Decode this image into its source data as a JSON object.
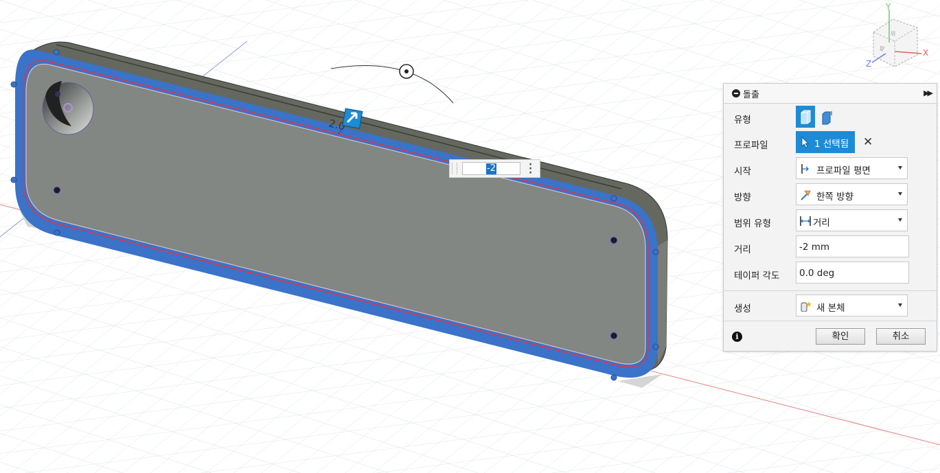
{
  "viewport": {
    "dimension_label": "2.0",
    "viewcube_faces": [
      "위",
      "앞"
    ],
    "axes": {
      "x": "X",
      "y": "Y",
      "z": "Z"
    }
  },
  "floating_input": {
    "value": "-2"
  },
  "panel": {
    "title": "돌출",
    "expand_icon": "double-chevron-right-icon",
    "rows": {
      "type": {
        "label": "유형"
      },
      "profile": {
        "label": "프로파일",
        "value": "1 선택됨"
      },
      "start": {
        "label": "시작",
        "value": "프로파일 평면"
      },
      "direction": {
        "label": "방향",
        "value": "한쪽 방향"
      },
      "extent": {
        "label": "범위 유형",
        "value": "거리"
      },
      "distance": {
        "label": "거리",
        "value": "-2 mm"
      },
      "taper": {
        "label": "테이퍼 각도",
        "value": "0.0 deg"
      },
      "operation": {
        "label": "생성",
        "value": "새 본체"
      }
    },
    "ok_label": "확인",
    "cancel_label": "취소",
    "info_glyph": "i"
  },
  "colors": {
    "accent": "#1d8bd6",
    "selected_face": "#3a73c8",
    "body": "#828784",
    "highlight_edge": "#e0354a"
  }
}
